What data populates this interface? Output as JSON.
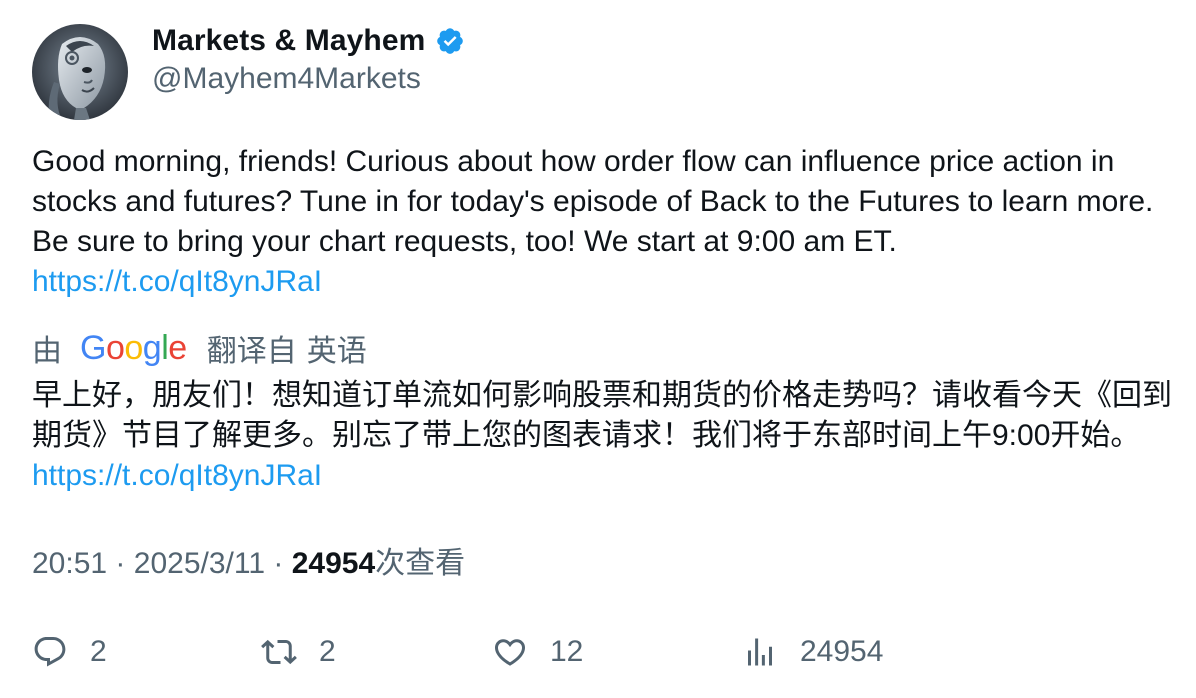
{
  "author": {
    "display_name": "Markets & Mayhem",
    "handle": "@Mayhem4Markets",
    "verified": true,
    "verified_color": "#1d9bf0",
    "avatar_icon": "robot-avatar"
  },
  "tweet": {
    "text": "Good morning, friends! Curious about how order flow can influence price action in stocks and futures? Tune in for today's episode of Back to the Futures to learn more. Be sure to bring your chart requests, too! We start at 9:00 am ET.",
    "link": "https://t.co/qIt8ynJRaI"
  },
  "translation": {
    "by_label": "由",
    "google_letters": [
      "G",
      "o",
      "o",
      "g",
      "l",
      "e"
    ],
    "translated_from_label": "翻译自",
    "source_language": "英语",
    "text": "早上好，朋友们！想知道订单流如何影响股票和期货的价格走势吗？请收看今天《回到期货》节目了解更多。别忘了带上您的图表请求！我们将于东部时间上午9:00开始。",
    "link": "https://t.co/qIt8ynJRaI"
  },
  "meta": {
    "time": "20:51",
    "separator": "·",
    "date": "2025/3/11",
    "views_count": "24954",
    "views_label": "次查看"
  },
  "actions": {
    "reply_count": "2",
    "retweet_count": "2",
    "like_count": "12",
    "views_count": "24954"
  },
  "colors": {
    "text_primary": "#0f1419",
    "text_secondary": "#536471",
    "link": "#1d9bf0"
  }
}
